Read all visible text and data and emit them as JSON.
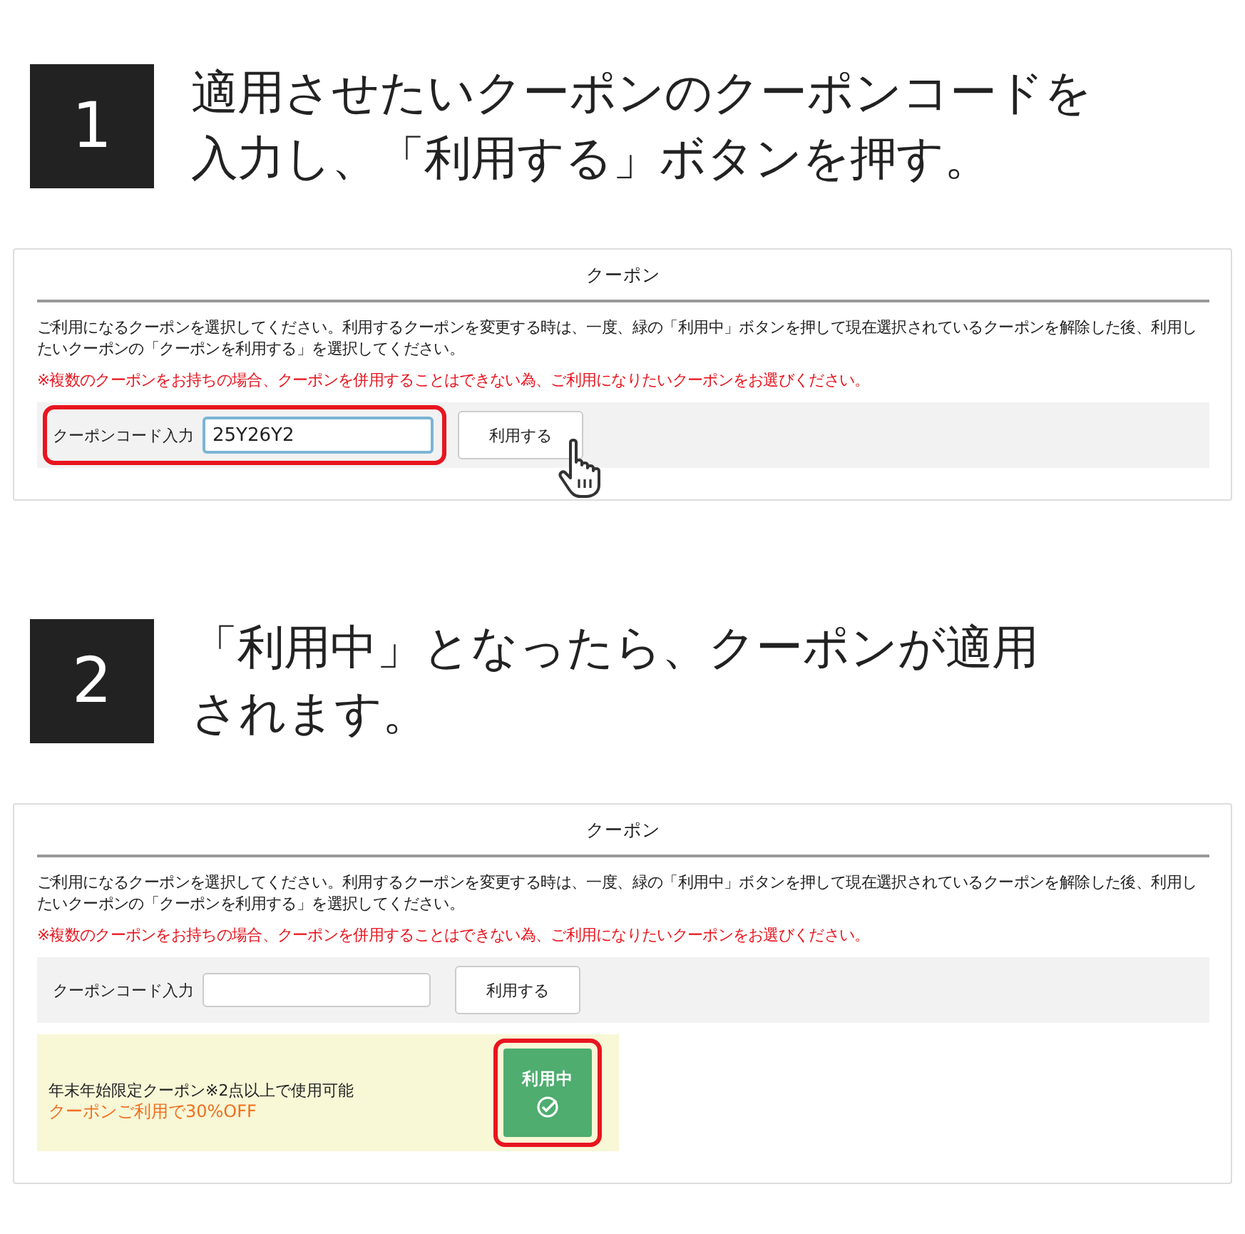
{
  "steps": [
    {
      "number": "1",
      "heading": [
        "適用させたいクーポンのクーポンコードを",
        "入力し、「利用する」ボタンを押す。"
      ],
      "panel": {
        "title": "クーポン",
        "description": "ご利用になるクーポンを選択してください。利用するクーポンを変更する時は、一度、緑の「利用中」ボタンを押して現在選択されているクーポンを解除した後、利用したいクーポンの「クーポンを利用する」を選択してください。",
        "warning": "※複数のクーポンをお持ちの場合、クーポンを併用することはできない為、ご利用になりたいクーポンをお選びください。",
        "code": {
          "label": "クーポンコード入力",
          "value": "25Y26Y2",
          "highlighted": true
        },
        "button": "利用する",
        "pointer": true
      }
    },
    {
      "number": "2",
      "heading": [
        "「利用中」となったら、クーポンが適用",
        "されます。"
      ],
      "panel": {
        "title": "クーポン",
        "description": "ご利用になるクーポンを選択してください。利用するクーポンを変更する時は、一度、緑の「利用中」ボタンを押して現在選択されているクーポンを解除した後、利用したいクーポンの「クーポンを利用する」を選択してください。",
        "warning": "※複数のクーポンをお持ちの場合、クーポンを併用することはできない為、ご利用になりたいクーポンをお選びください。",
        "code": {
          "label": "クーポンコード入力",
          "highlighted": false
        },
        "button": "利用する",
        "pointer": false,
        "coupon": {
          "name": "年末年始限定クーポン※2点以上で使用可能",
          "offer": "クーポンご利用で30%OFF",
          "status": "利用中",
          "applied": true,
          "highlighted": true
        }
      }
    }
  ]
}
